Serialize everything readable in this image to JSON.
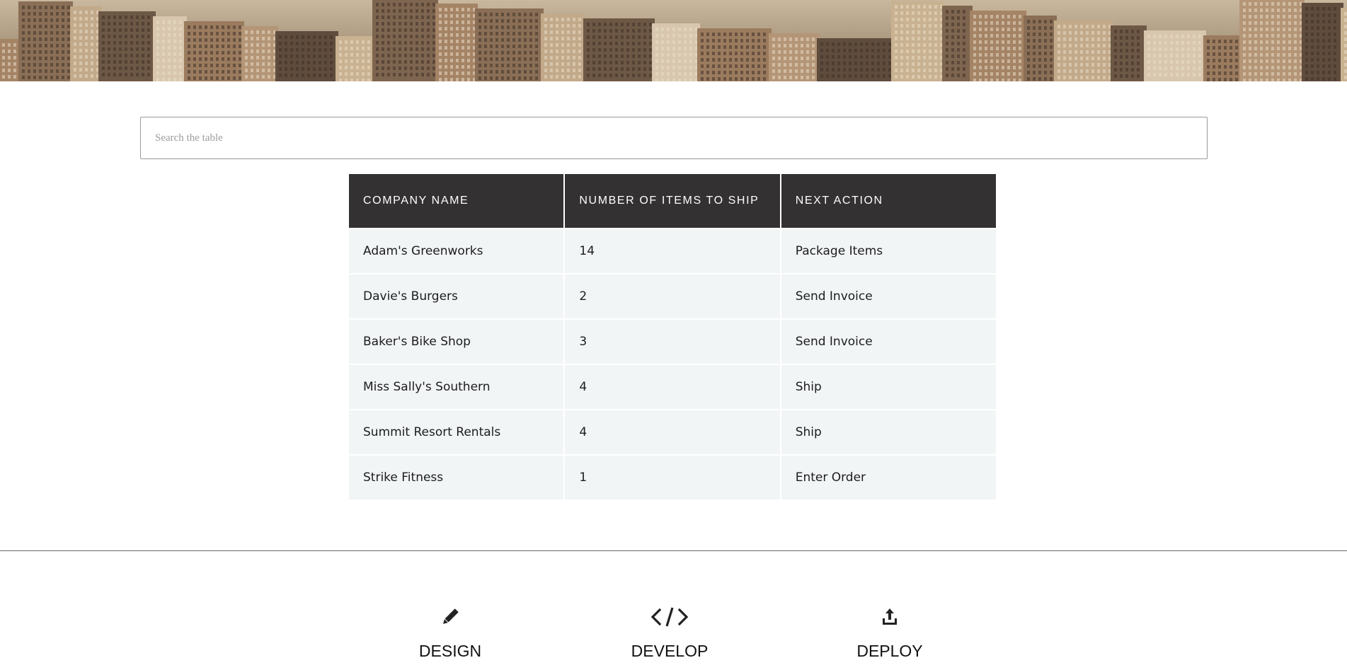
{
  "search": {
    "placeholder": "Search the table"
  },
  "table": {
    "headers": [
      "COMPANY NAME",
      "NUMBER OF ITEMS TO SHIP",
      "NEXT ACTION"
    ],
    "rows": [
      [
        "Adam's Greenworks",
        "14",
        "Package Items"
      ],
      [
        "Davie's Burgers",
        "2",
        "Send Invoice"
      ],
      [
        "Baker's Bike Shop",
        "3",
        "Send Invoice"
      ],
      [
        "Miss Sally's Southern",
        "4",
        "Ship"
      ],
      [
        "Summit Resort Rentals",
        "4",
        "Ship"
      ],
      [
        "Strike Fitness",
        "1",
        "Enter Order"
      ]
    ]
  },
  "features": [
    {
      "label": "DESIGN",
      "icon": "pencil-icon"
    },
    {
      "label": "DEVELOP",
      "icon": "code-icon"
    },
    {
      "label": "DEPLOY",
      "icon": "upload-icon"
    }
  ],
  "colors": {
    "header_bg": "#333132",
    "row_bg": "#f2f5f6"
  }
}
